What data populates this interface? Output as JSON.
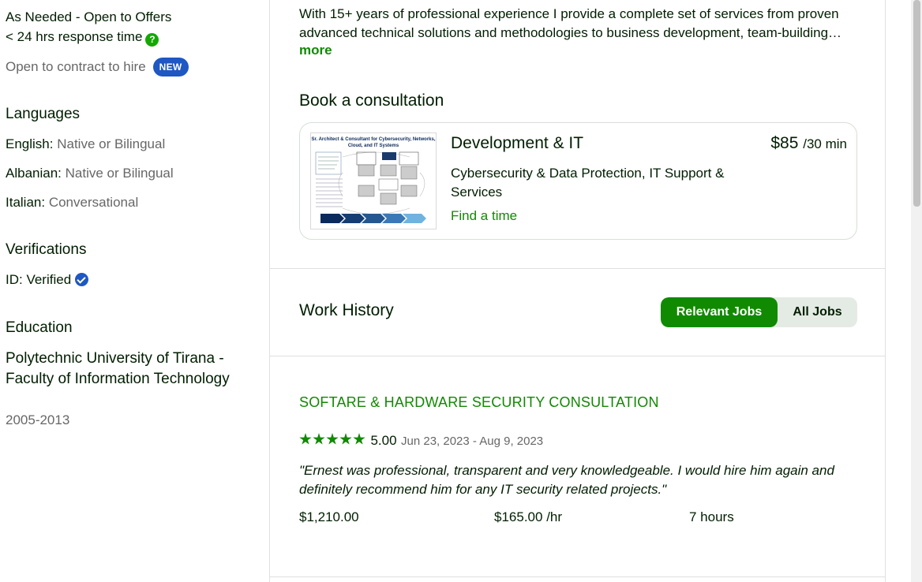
{
  "sidebar": {
    "availability": "As Needed - Open to Offers",
    "response_time": "< 24 hrs response time",
    "contract_to_hire": "Open to contract to hire",
    "new_badge": "NEW",
    "languages_heading": "Languages",
    "languages": [
      {
        "name": "English:",
        "level": "Native or Bilingual"
      },
      {
        "name": "Albanian:",
        "level": "Native or Bilingual"
      },
      {
        "name": "Italian:",
        "level": "Conversational"
      }
    ],
    "verifications_heading": "Verifications",
    "id_verified": "ID: Verified",
    "education_heading": "Education",
    "education": {
      "school": "Polytechnic University of Tirana - Faculty of Information Technology",
      "years": "2005-2013"
    }
  },
  "main": {
    "description": "With 15+ years of professional experience I provide a complete set of services from proven advanced technical solutions and methodologies to business development, team-building…",
    "more_label": "more",
    "consultation": {
      "heading": "Book a consultation",
      "thumbnail_title": "Sr. Architect & Consultant for Cybersecurity, Networks, Cloud, and IT Systems",
      "category": "Development & IT",
      "price": "$85",
      "price_unit": "/30 min",
      "subcategory": "Cybersecurity & Data Protection, IT Support & Services",
      "find_time": "Find a time"
    },
    "work_history": {
      "heading": "Work History",
      "tabs": {
        "relevant": "Relevant Jobs",
        "all": "All Jobs"
      },
      "jobs": [
        {
          "title": "SOFTARE & HARDWARE SECURITY CONSULTATION",
          "rating": "5.00",
          "stars": 5,
          "dates": "Jun 23, 2023 - Aug 9, 2023",
          "review": "\"Ernest was professional, transparent and very knowledgeable. I would hire him again and definitely recommend him for any IT security related projects.\"",
          "earned": "$1,210.00",
          "rate": "$165.00",
          "rate_unit": "/hr",
          "hours": "7 hours"
        }
      ]
    }
  },
  "colors": {
    "brand_green": "#108a00",
    "badge_blue": "#1f57c3",
    "text_dark": "#001e00",
    "text_muted": "#676767"
  }
}
